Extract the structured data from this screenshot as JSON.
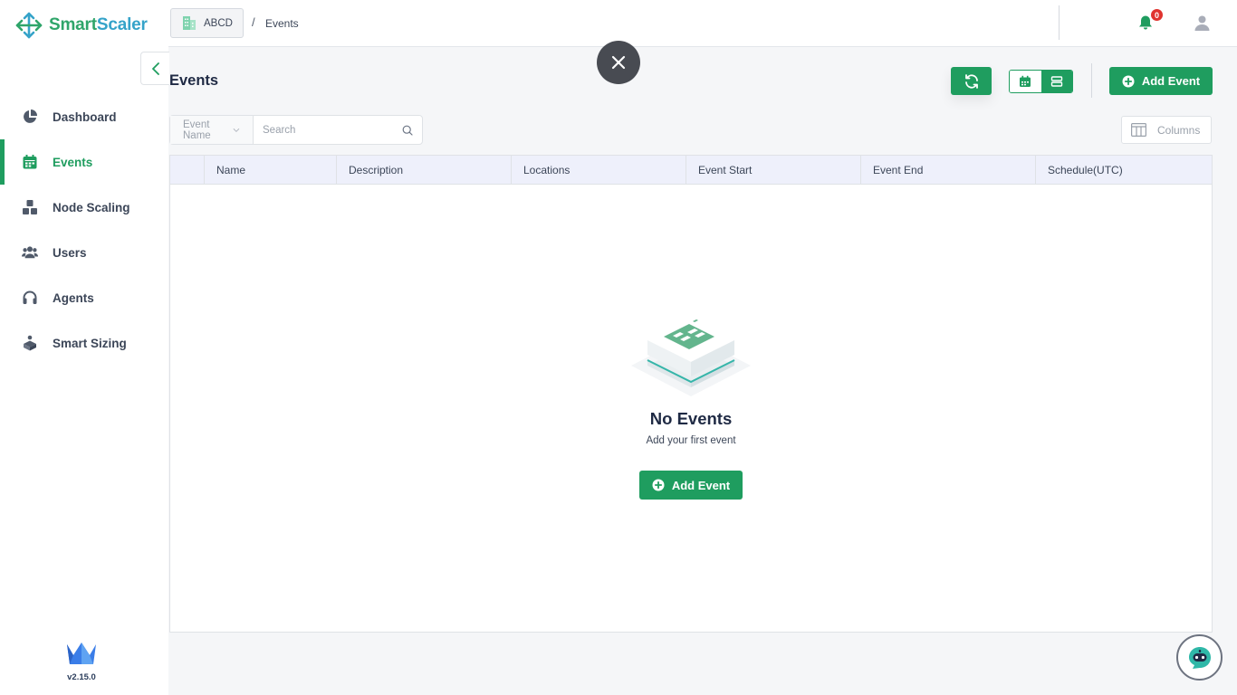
{
  "app": {
    "logo_part1": "Smart",
    "logo_part2": "Scaler",
    "version": "v2.15.0"
  },
  "topbar": {
    "org": "ABCD",
    "separator": "/",
    "current_page": "Events",
    "notification_count": "0"
  },
  "sidebar": {
    "items": [
      {
        "label": "Dashboard",
        "icon": "pie-chart-icon",
        "active": false
      },
      {
        "label": "Events",
        "icon": "calendar-icon",
        "active": true
      },
      {
        "label": "Node Scaling",
        "icon": "cubes-icon",
        "active": false
      },
      {
        "label": "Users",
        "icon": "users-icon",
        "active": false
      },
      {
        "label": "Agents",
        "icon": "headset-icon",
        "active": false
      },
      {
        "label": "Smart Sizing",
        "icon": "box-person-icon",
        "active": false
      }
    ]
  },
  "page": {
    "title": "Events",
    "add_label": "Add Event",
    "filter": {
      "field": "Event Name",
      "search_placeholder": "Search"
    },
    "columns_label": "Columns"
  },
  "table": {
    "columns": [
      "Name",
      "Description",
      "Locations",
      "Event Start",
      "Event End",
      "Schedule(UTC)"
    ]
  },
  "empty": {
    "title": "No Events",
    "subtitle": "Add your first event",
    "add_label": "Add Event"
  },
  "colors": {
    "primary": "#1f9d5f",
    "logo_blue": "#35a3c9",
    "badge": "#e0342f"
  }
}
